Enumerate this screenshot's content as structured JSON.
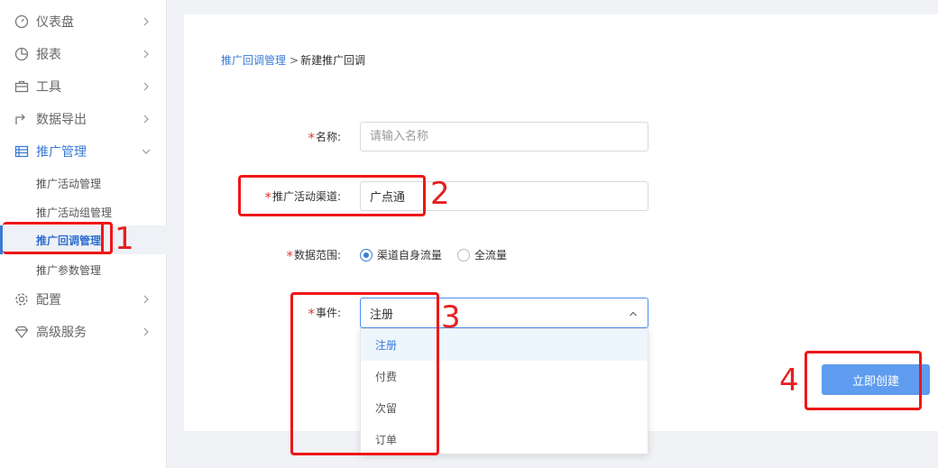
{
  "sidebar": {
    "menu": [
      {
        "label": "仪表盘",
        "icon": "dashboard-icon"
      },
      {
        "label": "报表",
        "icon": "pie-chart-icon"
      },
      {
        "label": "工具",
        "icon": "toolbox-icon"
      },
      {
        "label": "数据导出",
        "icon": "export-icon"
      },
      {
        "label": "推广管理",
        "icon": "list-icon"
      },
      {
        "label": "配置",
        "icon": "gear-icon"
      },
      {
        "label": "高级服务",
        "icon": "diamond-icon"
      }
    ],
    "submenu": [
      {
        "label": "推广活动管理"
      },
      {
        "label": "推广活动组管理"
      },
      {
        "label": "推广回调管理"
      },
      {
        "label": "推广参数管理"
      }
    ]
  },
  "breadcrumb": {
    "parent": "推广回调管理",
    "separator": ">",
    "current": "新建推广回调"
  },
  "form": {
    "required_mark": "*",
    "name": {
      "label": "名称:",
      "placeholder": "请输入名称",
      "value": ""
    },
    "channel": {
      "label": "推广活动渠道:",
      "value": "广点通"
    },
    "range": {
      "label": "数据范围:",
      "options": [
        "渠道自身流量",
        "全流量"
      ],
      "selected": "渠道自身流量"
    },
    "event": {
      "label": "事件:",
      "value": "注册",
      "options": [
        "注册",
        "付费",
        "次留",
        "订单"
      ]
    }
  },
  "actions": {
    "create_label": "立即创建"
  },
  "annotations": [
    "1",
    "2",
    "3",
    "4"
  ],
  "colors": {
    "accent": "#3a7bd5",
    "button": "#5f9cef",
    "annotation": "#f01616",
    "required": "#e03a3a"
  }
}
